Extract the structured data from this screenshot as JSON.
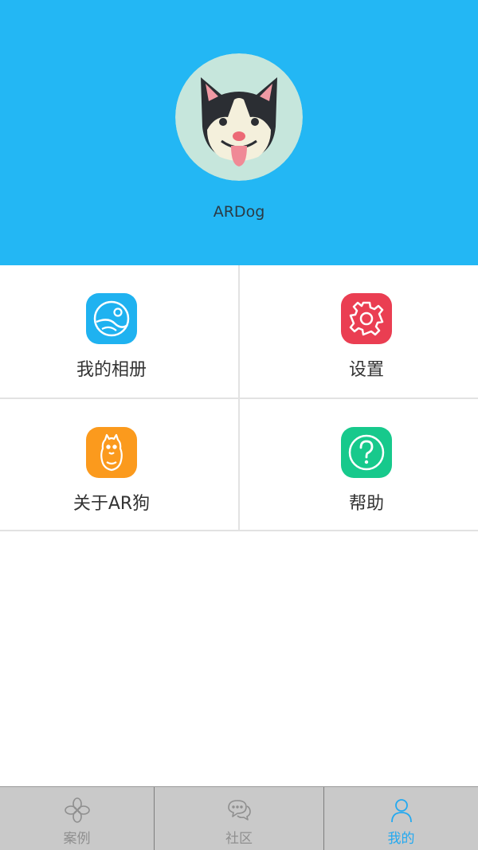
{
  "theme": {
    "header_bg": "#23b7f4",
    "divider": "#e2e2e2",
    "tabbar_bg": "#c9c9c9",
    "tab_active_color": "#23a9f0",
    "tab_inactive_color": "#8f8f8f"
  },
  "profile": {
    "username": "ARDog",
    "avatar_icon": "husky-dog-avatar"
  },
  "menu": {
    "items": [
      {
        "label": "我的相册",
        "icon": "photo-album-icon",
        "color": "#1fb2f0"
      },
      {
        "label": "设置",
        "icon": "gear-icon",
        "color": "#ea3e52"
      },
      {
        "label": "关于AR狗",
        "icon": "dog-icon",
        "color": "#fb9a1d"
      },
      {
        "label": "帮助",
        "icon": "help-icon",
        "color": "#17c98c"
      }
    ]
  },
  "tabbar": {
    "tabs": [
      {
        "label": "案例",
        "icon": "clover-icon",
        "active": false
      },
      {
        "label": "社区",
        "icon": "chat-bubbles-icon",
        "active": false
      },
      {
        "label": "我的",
        "icon": "person-icon",
        "active": true
      }
    ]
  }
}
